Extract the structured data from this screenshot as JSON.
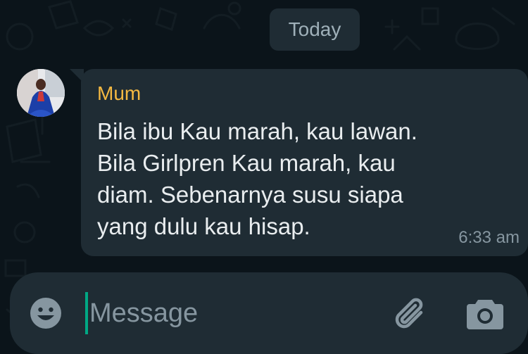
{
  "chat": {
    "date_separator": "Today",
    "message": {
      "sender": "Mum",
      "lines": [
        "Bila ibu Kau marah, kau lawan.",
        "Bila Girlpren Kau marah, kau",
        "diam. Sebenarnya susu siapa",
        "yang dulu kau hisap."
      ],
      "time": "6:33 am"
    }
  },
  "composer": {
    "placeholder": "Message",
    "value": ""
  },
  "icons": {
    "emoji": "emoji-icon",
    "attach": "paperclip-icon",
    "camera": "camera-icon"
  },
  "colors": {
    "background": "#0b141a",
    "bubble": "#1f2c34",
    "sender": "#f5b942",
    "text": "#e9edef",
    "muted": "#8696a0",
    "cursor": "#00a884"
  }
}
